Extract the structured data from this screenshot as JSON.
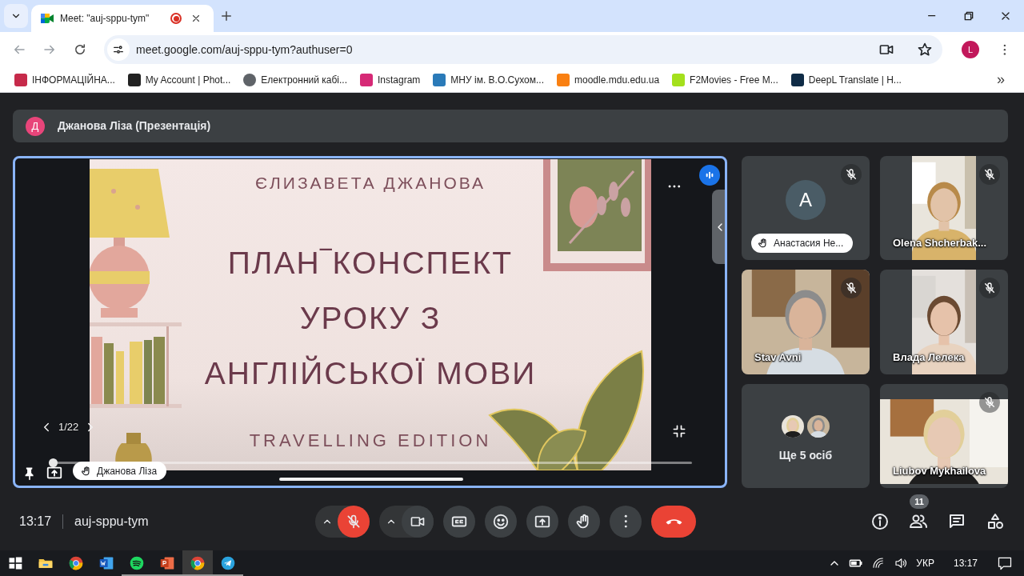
{
  "browser": {
    "tab": {
      "title": "Meet: \"auj-sppu-tym\"",
      "recording": true
    },
    "url": "meet.google.com/auj-sppu-tym?authuser=0",
    "profile_initial": "L",
    "bookmarks": [
      {
        "label": "ІНФОРМАЦІЙНА...",
        "color": "#c62a4a"
      },
      {
        "label": "My Account | Phot...",
        "color": "#222222"
      },
      {
        "label": "Електронний кабі...",
        "color": "#5f6368"
      },
      {
        "label": "Instagram",
        "color": "#d62976"
      },
      {
        "label": "МНУ ім. В.О.Сухом...",
        "color": "#2a7ab8"
      },
      {
        "label": "moodle.mdu.edu.ua",
        "color": "#f98012"
      },
      {
        "label": "F2Movies - Free M...",
        "color": "#a4e01c"
      },
      {
        "label": "DeepL Translate | H...",
        "color": "#0f2b46"
      }
    ],
    "bookmarks_more": "»"
  },
  "meet": {
    "banner": {
      "initial": "Д",
      "title": "Джанова Ліза (Презентація)"
    },
    "slide": {
      "author": "ЄЛИЗАВЕТА ДЖАНОВА",
      "title_lines": [
        "ПЛАН‾КОНСПЕКТ",
        "УРОКУ З",
        "АНГЛІЙСЬКОЇ МОВИ"
      ],
      "subtitle": "TRAVELLING EDITION",
      "page": "1/22"
    },
    "presenter_chip": "Джанова Ліза",
    "tiles": [
      {
        "kind": "avatar",
        "initial": "A",
        "name": "Анастасия Не...",
        "hand_raised": true,
        "muted": true
      },
      {
        "kind": "portrait",
        "name": "Olena Shcherbak...",
        "hand_raised": false,
        "muted": true
      },
      {
        "kind": "fullframe",
        "name": "Stav Avni",
        "hand_raised": false,
        "muted": true
      },
      {
        "kind": "portrait",
        "name": "Влада Лелека",
        "hand_raised": false,
        "muted": true
      },
      {
        "kind": "others",
        "name": "Ще 5 осіб",
        "hand_raised": false,
        "muted": false
      },
      {
        "kind": "letterbox",
        "name": "Liubov Mykhailova",
        "hand_raised": false,
        "muted": true
      }
    ],
    "time": "13:17",
    "meeting_code": "auj-sppu-tym",
    "controls": [
      {
        "kind": "mic",
        "on": false
      },
      {
        "kind": "camera",
        "on": true
      },
      {
        "kind": "captions"
      },
      {
        "kind": "reactions"
      },
      {
        "kind": "present"
      },
      {
        "kind": "raise_hand"
      },
      {
        "kind": "more"
      },
      {
        "kind": "leave"
      }
    ],
    "side_controls": [
      {
        "kind": "info"
      },
      {
        "kind": "people",
        "badge": "11"
      },
      {
        "kind": "chat"
      },
      {
        "kind": "activities"
      }
    ]
  },
  "taskbar": {
    "apps": [
      {
        "kind": "start",
        "selected": false,
        "running": false
      },
      {
        "kind": "explorer",
        "selected": false,
        "running": false
      },
      {
        "kind": "chrome",
        "selected": false,
        "running": false
      },
      {
        "kind": "word",
        "selected": false,
        "running": false
      },
      {
        "kind": "spotify",
        "selected": false,
        "running": true
      },
      {
        "kind": "powerpoint",
        "selected": false,
        "running": true
      },
      {
        "kind": "chrome",
        "selected": true,
        "running": true
      },
      {
        "kind": "telegram",
        "selected": false,
        "running": true
      }
    ],
    "language": "УКР",
    "time": "13:17"
  }
}
